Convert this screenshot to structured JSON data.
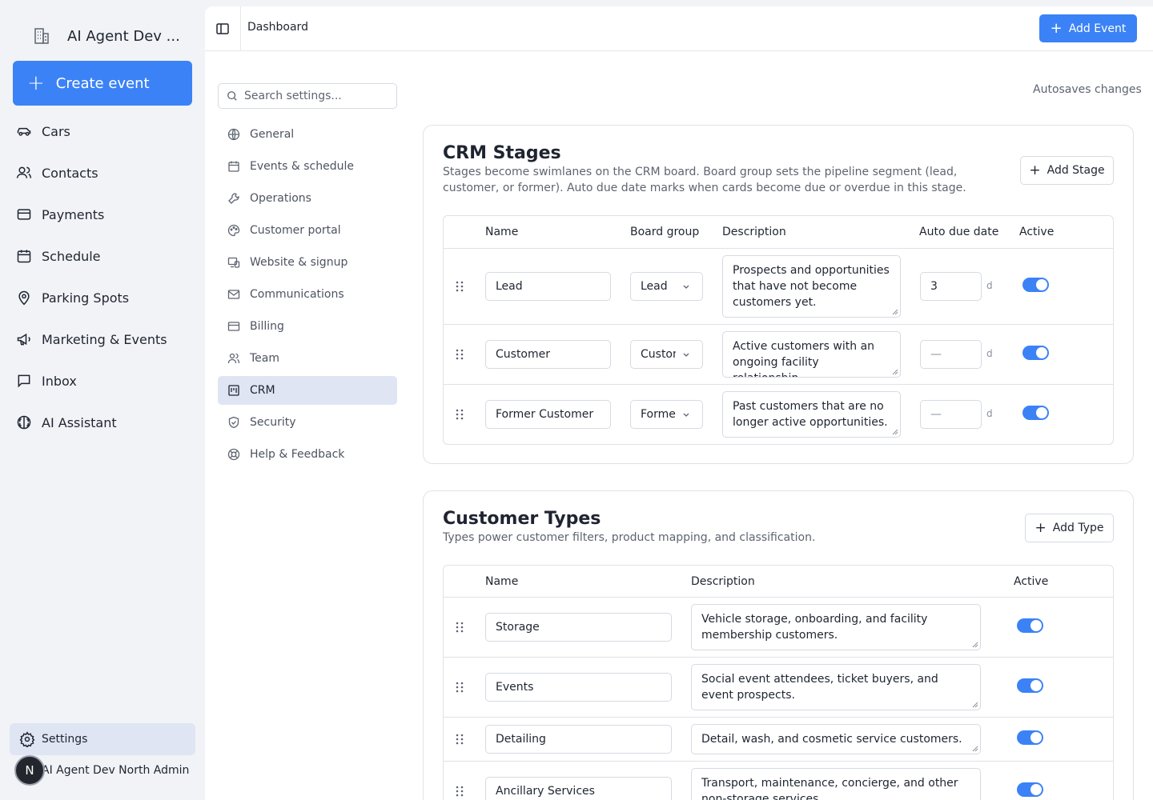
{
  "sidebar": {
    "org_name": "AI Agent Dev ...",
    "create_label": "Create event",
    "items": [
      {
        "label": "Cars",
        "icon": "car-icon"
      },
      {
        "label": "Contacts",
        "icon": "users-icon"
      },
      {
        "label": "Payments",
        "icon": "credit-card-icon"
      },
      {
        "label": "Schedule",
        "icon": "calendar-icon"
      },
      {
        "label": "Parking Spots",
        "icon": "map-pin-icon"
      },
      {
        "label": "Marketing & Events",
        "icon": "megaphone-icon"
      },
      {
        "label": "Inbox",
        "icon": "inbox-icon"
      },
      {
        "label": "AI Assistant",
        "icon": "brain-icon"
      }
    ],
    "settings_label": "Settings",
    "user": {
      "initial": "N",
      "name": "AI Agent Dev North Admin"
    }
  },
  "topbar": {
    "breadcrumb": "Dashboard",
    "add_event_label": "Add Event"
  },
  "settings_nav": {
    "search_placeholder": "Search settings...",
    "items": [
      {
        "label": "General"
      },
      {
        "label": "Events & schedule"
      },
      {
        "label": "Operations"
      },
      {
        "label": "Customer portal"
      },
      {
        "label": "Website & signup"
      },
      {
        "label": "Communications"
      },
      {
        "label": "Billing"
      },
      {
        "label": "Team"
      },
      {
        "label": "CRM",
        "active": true
      },
      {
        "label": "Security"
      },
      {
        "label": "Help & Feedback"
      }
    ]
  },
  "autosave_text": "Autosaves changes",
  "crm_stages": {
    "title": "CRM Stages",
    "description": "Stages become swimlanes on the CRM board. Board group sets the pipeline segment (lead, customer, or former). Auto due date marks when cards become due or overdue in this stage.",
    "add_label": "Add Stage",
    "columns": [
      "Name",
      "Board group",
      "Description",
      "Auto due date",
      "Active"
    ],
    "unit": "d",
    "rows": [
      {
        "name": "Lead",
        "group": "Lead",
        "description": "Prospects and opportunities that have not become customers yet.",
        "due": "3",
        "active": true
      },
      {
        "name": "Customer",
        "group": "Customer",
        "description": "Active customers with an ongoing facility relationship.",
        "due": "—",
        "active": true
      },
      {
        "name": "Former Customer",
        "group": "Former",
        "description": "Past customers that are no longer active opportunities.",
        "due": "—",
        "active": true
      }
    ]
  },
  "customer_types": {
    "title": "Customer Types",
    "description": "Types power customer filters, product mapping, and classification.",
    "add_label": "Add Type",
    "columns": [
      "Name",
      "Description",
      "Active"
    ],
    "rows": [
      {
        "name": "Storage",
        "description": "Vehicle storage, onboarding, and facility membership customers.",
        "active": true
      },
      {
        "name": "Events",
        "description": "Social event attendees, ticket buyers, and event prospects.",
        "active": true
      },
      {
        "name": "Detailing",
        "description": "Detail, wash, and cosmetic service customers.",
        "active": true
      },
      {
        "name": "Ancillary Services",
        "description": "Transport, maintenance, concierge, and other non-storage services.",
        "active": true
      }
    ]
  }
}
